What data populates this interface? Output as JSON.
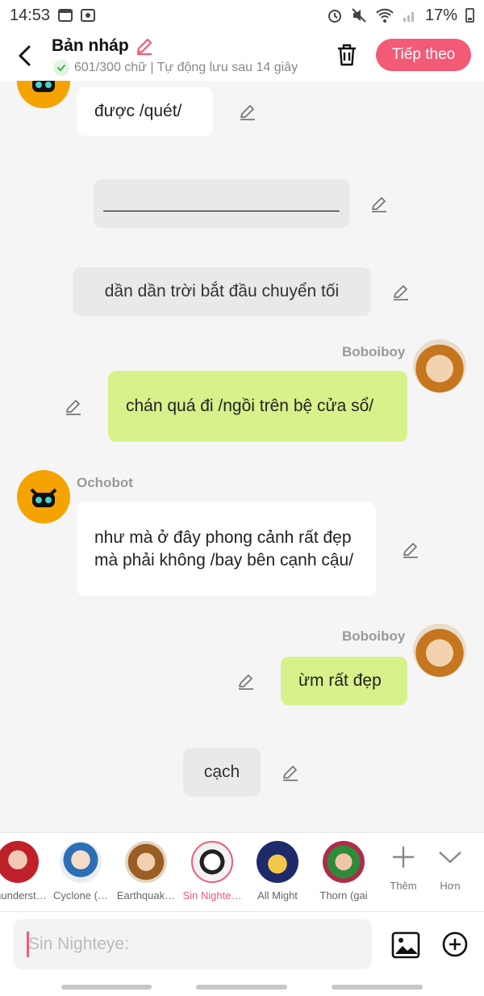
{
  "status_bar": {
    "time": "14:53",
    "battery": "17%"
  },
  "header": {
    "title": "Bản nháp",
    "subtitle": "601/300 chữ | Tự động lưu sau 14 giây",
    "next_label": "Tiếp theo"
  },
  "messages": [
    {
      "text": "được /quét/"
    },
    {
      "text": "_________________________"
    },
    {
      "text": "dần dần trời bắt đầu chuyển tối"
    },
    {
      "sender": "Boboiboy",
      "text": "chán quá đi /ngồi trên bệ cửa sổ/"
    },
    {
      "sender": "Ochobot",
      "text": "như mà ở đây phong cảnh rất đẹp mà phải không /bay bên cạnh cậu/"
    },
    {
      "sender": "Boboiboy",
      "text": "ừm rất đẹp"
    },
    {
      "text": "cạch"
    }
  ],
  "characters": [
    {
      "label": "Thunderst…"
    },
    {
      "label": "Cyclone (…"
    },
    {
      "label": "Earthquak…"
    },
    {
      "label": "Sin Nighte…"
    },
    {
      "label": "All Might"
    },
    {
      "label": "Thorn (gai"
    }
  ],
  "strip_buttons": {
    "more_label": "Thêm",
    "expand_label": "Hơn"
  },
  "input": {
    "placeholder": "Sin Nighteye:"
  },
  "colors": {
    "accent": "#f25a76",
    "user_bubble": "#d7f28a",
    "ochobot_avatar": "#f5a300"
  },
  "icons": {
    "back": "back-arrow-icon",
    "edit": "pencil-icon",
    "delete": "trash-icon",
    "image": "image-icon",
    "add": "plus-circle-icon"
  }
}
